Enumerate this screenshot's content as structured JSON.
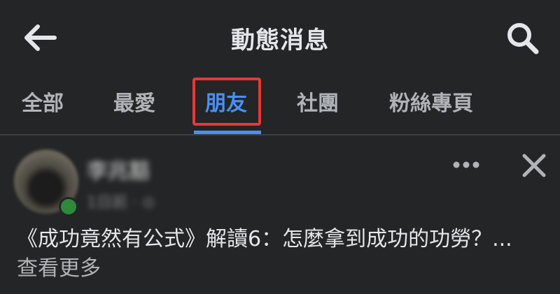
{
  "header": {
    "title": "動態消息",
    "back_icon": "back-arrow-icon",
    "search_icon": "search-icon"
  },
  "tabs": [
    {
      "label": "全部"
    },
    {
      "label": "最愛"
    },
    {
      "label": "朋友",
      "active": true
    },
    {
      "label": "社團"
    },
    {
      "label": "粉絲專頁"
    }
  ],
  "colors": {
    "background": "#242526",
    "accent": "#4a90f0",
    "highlight": "#e53935"
  },
  "post": {
    "author": "李兆豁",
    "meta": "1日前 · ⊙",
    "text": "《成功竟然有公式》解讀6：怎麼拿到成功的功勞？",
    "ellipsis": "... ",
    "see_more": "查看更多",
    "more_icon": "more-options-icon",
    "close_icon": "close-icon"
  }
}
